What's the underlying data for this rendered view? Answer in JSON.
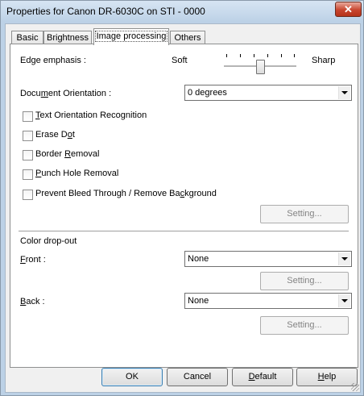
{
  "window": {
    "title": "Properties for Canon DR-6030C on STI - 0000",
    "close_label": "✕"
  },
  "tabs": [
    {
      "label": "Basic",
      "active": false
    },
    {
      "label": "Brightness",
      "active": false
    },
    {
      "label": "Image processing",
      "active": true
    },
    {
      "label": "Others",
      "active": false
    }
  ],
  "edge_emphasis": {
    "label": "Edge emphasis :",
    "low_label": "Soft",
    "high_label": "Sharp",
    "level": 0.5
  },
  "orientation": {
    "label": "Document Orientation :",
    "value": "0 degrees"
  },
  "checkboxes": [
    {
      "label": "Text Orientation Recognition",
      "checked": false
    },
    {
      "label": "Erase Dot",
      "checked": false
    },
    {
      "label": "Border Removal",
      "checked": false
    },
    {
      "label": "Punch Hole Removal",
      "checked": false
    },
    {
      "label": "Prevent Bleed Through / Remove Background",
      "checked": false
    }
  ],
  "setting_label": "Setting...",
  "color_dropout": {
    "heading": "Color drop-out",
    "front_label": "Front :",
    "front_value": "None",
    "back_label": "Back :",
    "back_value": "None"
  },
  "footer": {
    "ok": "OK",
    "cancel": "Cancel",
    "default": "Default",
    "help": "Help"
  },
  "colors": {
    "title_bar": "#bcd1e6",
    "close_button": "#c8452e",
    "panel": "#ffffff",
    "dialog": "#f0f0f0"
  }
}
